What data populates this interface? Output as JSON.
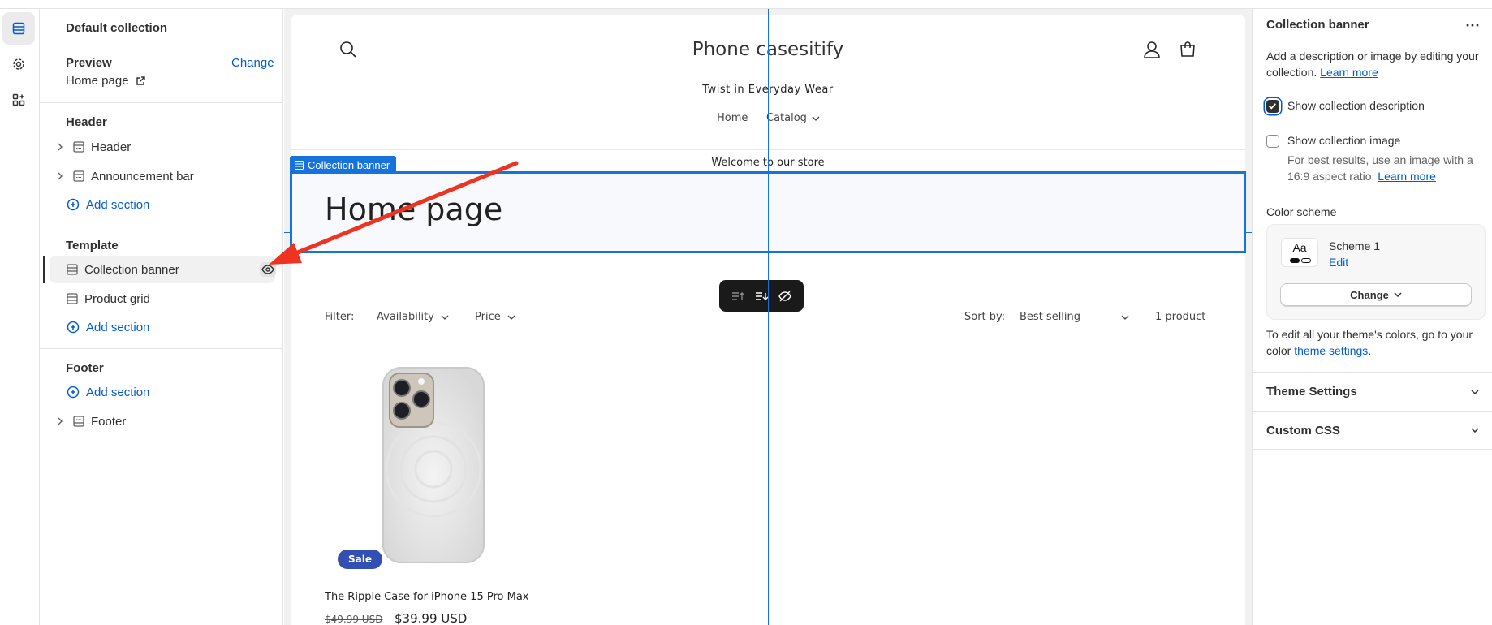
{
  "left": {
    "collection_title": "Default collection",
    "preview_label": "Preview",
    "change_label": "Change",
    "preview_page": "Home page",
    "groups": {
      "header": {
        "title": "Header",
        "items": [
          "Header",
          "Announcement bar"
        ],
        "add": "Add section"
      },
      "template": {
        "title": "Template",
        "items": [
          "Collection banner",
          "Product grid"
        ],
        "add": "Add section"
      },
      "footer": {
        "title": "Footer",
        "add": "Add section",
        "items": [
          "Footer"
        ]
      }
    }
  },
  "store": {
    "name": "Phone casesitify",
    "tagline": "Twist in Everyday Wear",
    "nav": [
      "Home",
      "Catalog"
    ],
    "announcement": "Welcome to our store",
    "section_tag": "Collection banner",
    "banner_title": "Home page",
    "filter_label": "Filter:",
    "filters": [
      "Availability",
      "Price"
    ],
    "sort_label": "Sort by:",
    "sort_value": "Best selling",
    "product_count": "1 product",
    "product": {
      "badge": "Sale",
      "title": "The Ripple Case for iPhone 15 Pro Max",
      "old_price": "$49.99 USD",
      "price": "$39.99 USD"
    }
  },
  "right": {
    "title": "Collection banner",
    "desc_1": "Add a description or image by editing your",
    "desc_2": "collection.",
    "learn_more": "Learn more",
    "show_desc": "Show collection description",
    "show_desc_checked": true,
    "show_image": "Show collection image",
    "show_image_checked": false,
    "image_hint_1": "For best results, use an image with a",
    "image_hint_2": "16:9 aspect ratio.",
    "learn_more_2": "Learn more",
    "color_scheme_label": "Color scheme",
    "scheme_sample": "Aa",
    "scheme_name": "Scheme 1",
    "edit_label": "Edit",
    "change_btn": "Change",
    "theme_note_1": "To edit all your theme's colors, go to your",
    "theme_note_2": "color",
    "theme_settings_link": "theme settings",
    "period": ".",
    "theme_settings": "Theme Settings",
    "custom_css": "Custom CSS"
  },
  "colors": {
    "accent": "#005bd3",
    "selection": "#1773dc",
    "badge": "#334fb4",
    "arrow": "#ee3322"
  }
}
